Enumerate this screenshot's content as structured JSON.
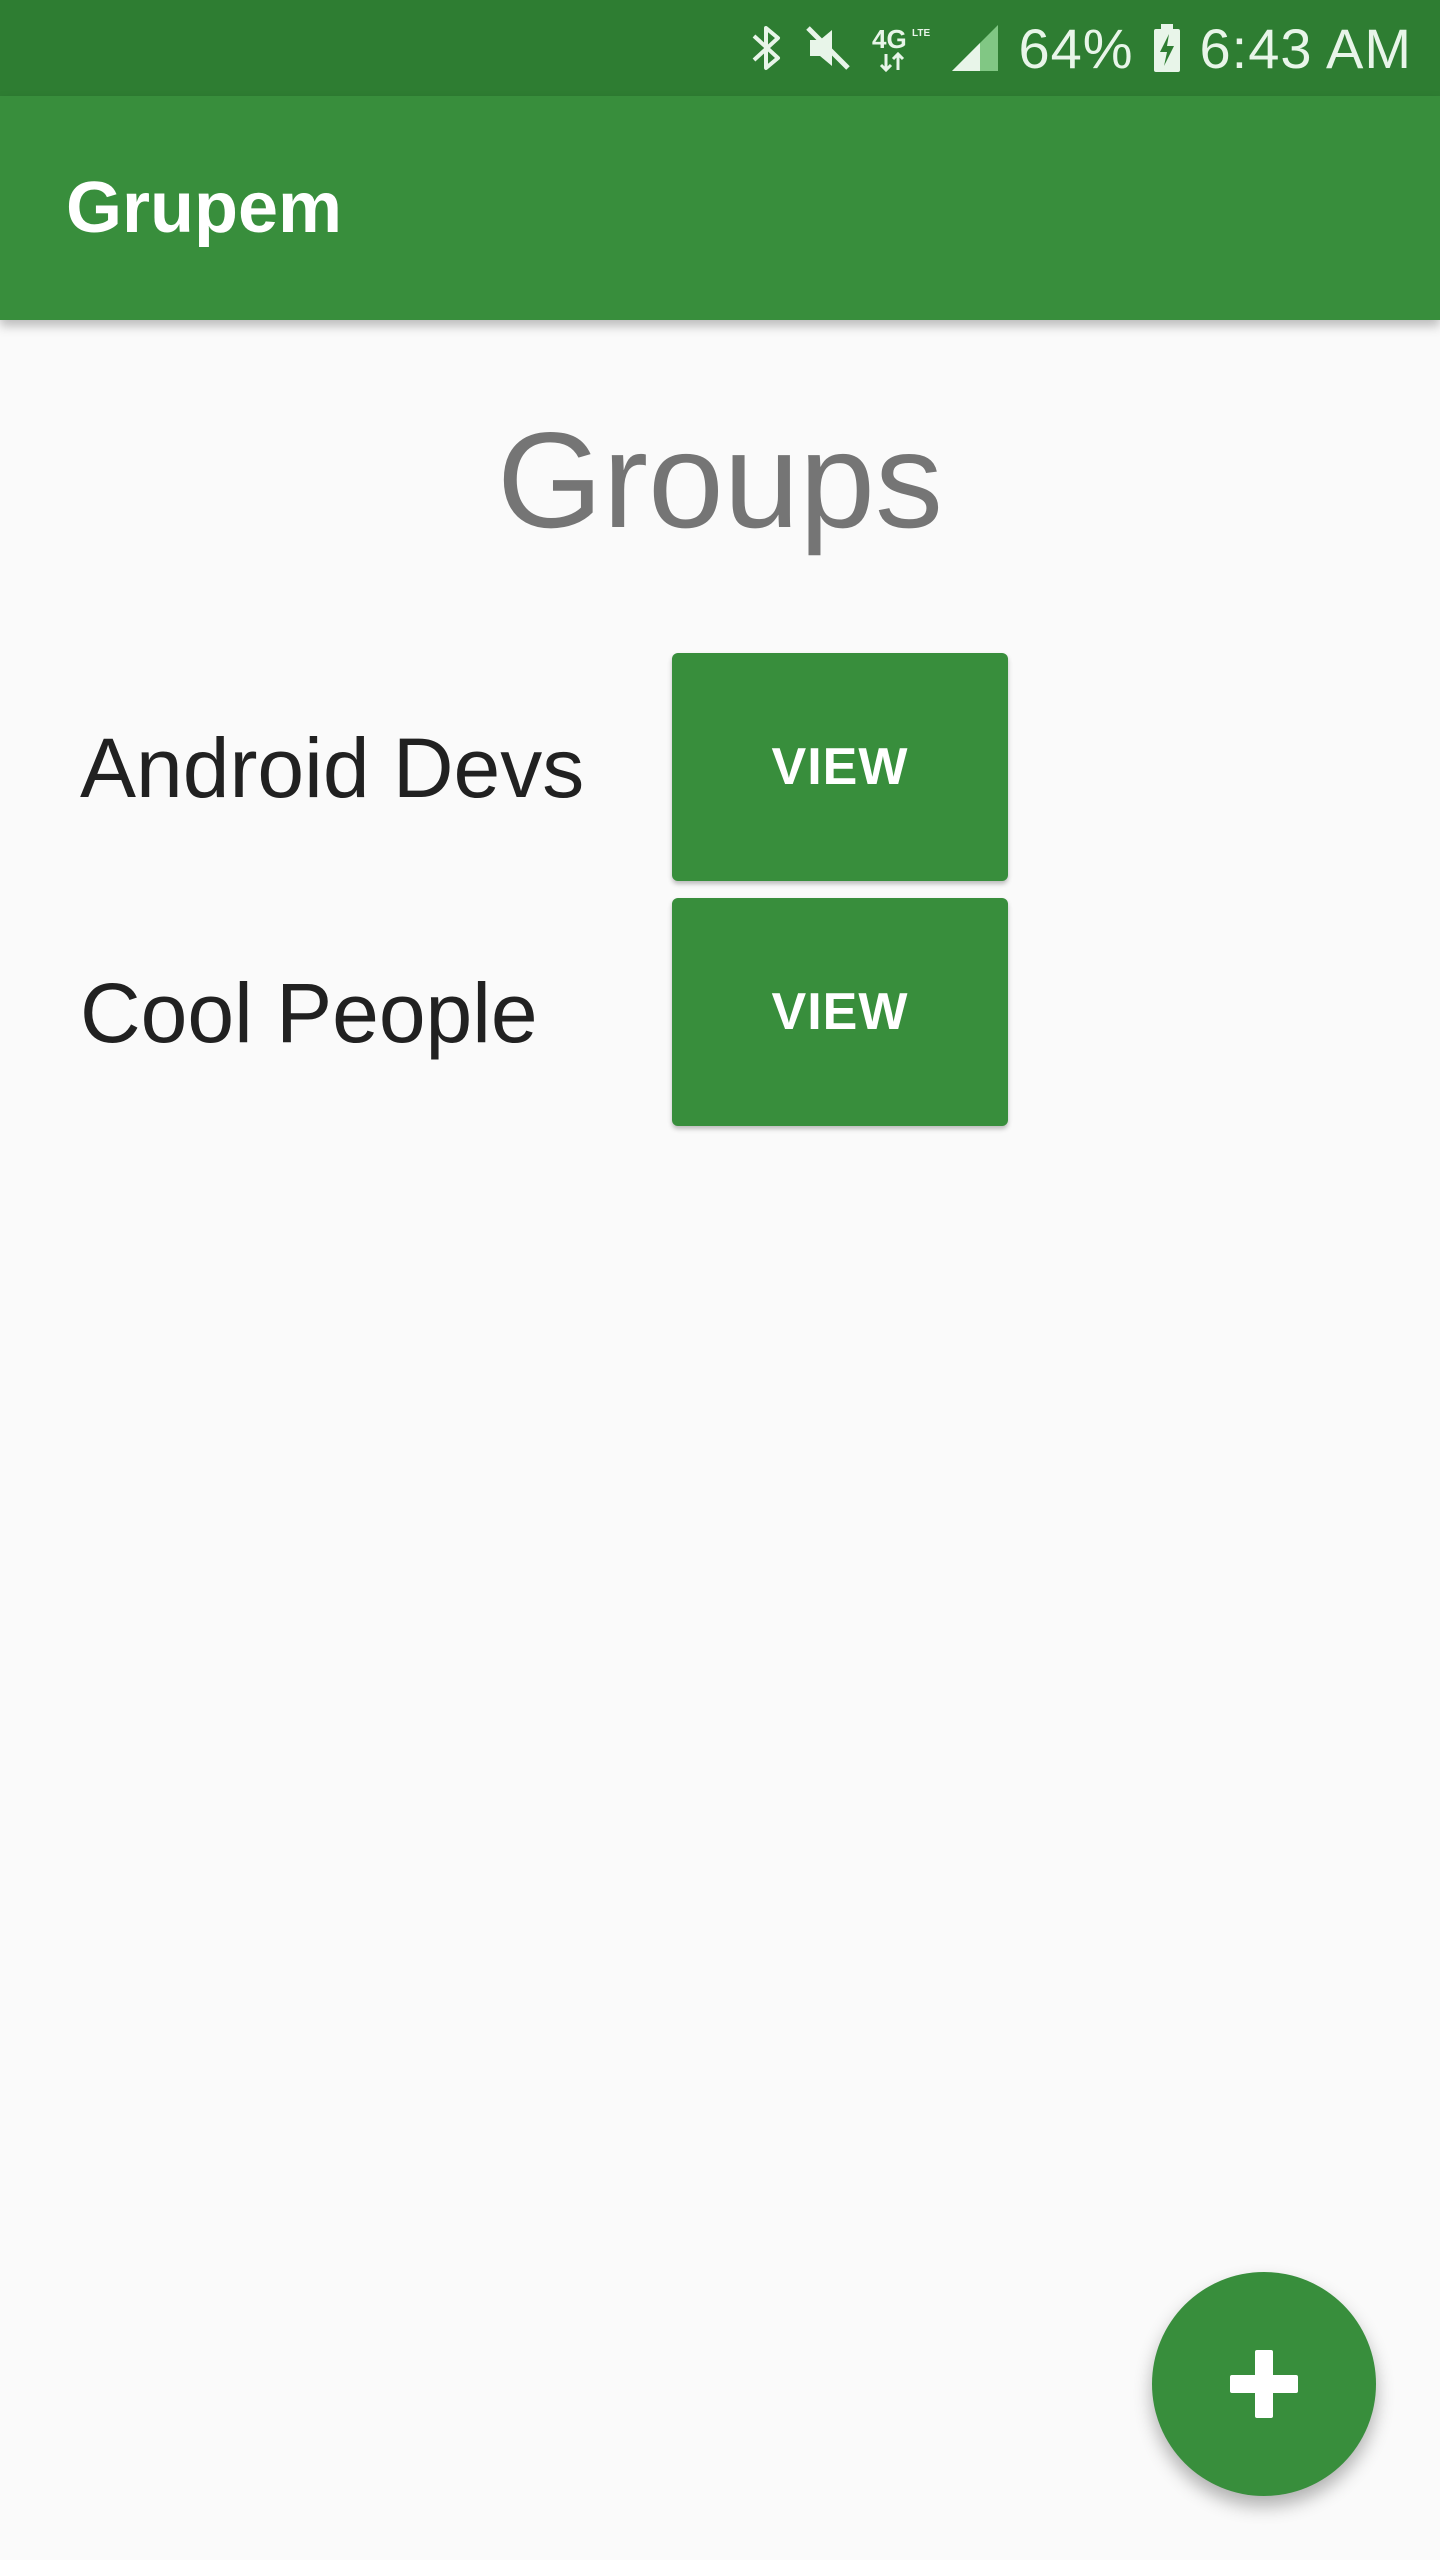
{
  "status_bar": {
    "battery": "64%",
    "time": "6:43 AM",
    "icons": [
      "bluetooth-icon",
      "mute-icon",
      "4g-lte-icon",
      "signal-icon",
      "battery-charging-icon"
    ]
  },
  "app_bar": {
    "title": "Grupem"
  },
  "main": {
    "heading": "Groups",
    "groups": [
      {
        "name": "Android Devs",
        "button_label": "VIEW"
      },
      {
        "name": "Cool People",
        "button_label": "VIEW"
      }
    ]
  },
  "fab": {
    "icon": "add-icon"
  },
  "colors": {
    "status_bar": "#2e7d32",
    "primary": "#388e3c",
    "background": "#fafafa",
    "heading": "#757575",
    "text": "#212121"
  }
}
